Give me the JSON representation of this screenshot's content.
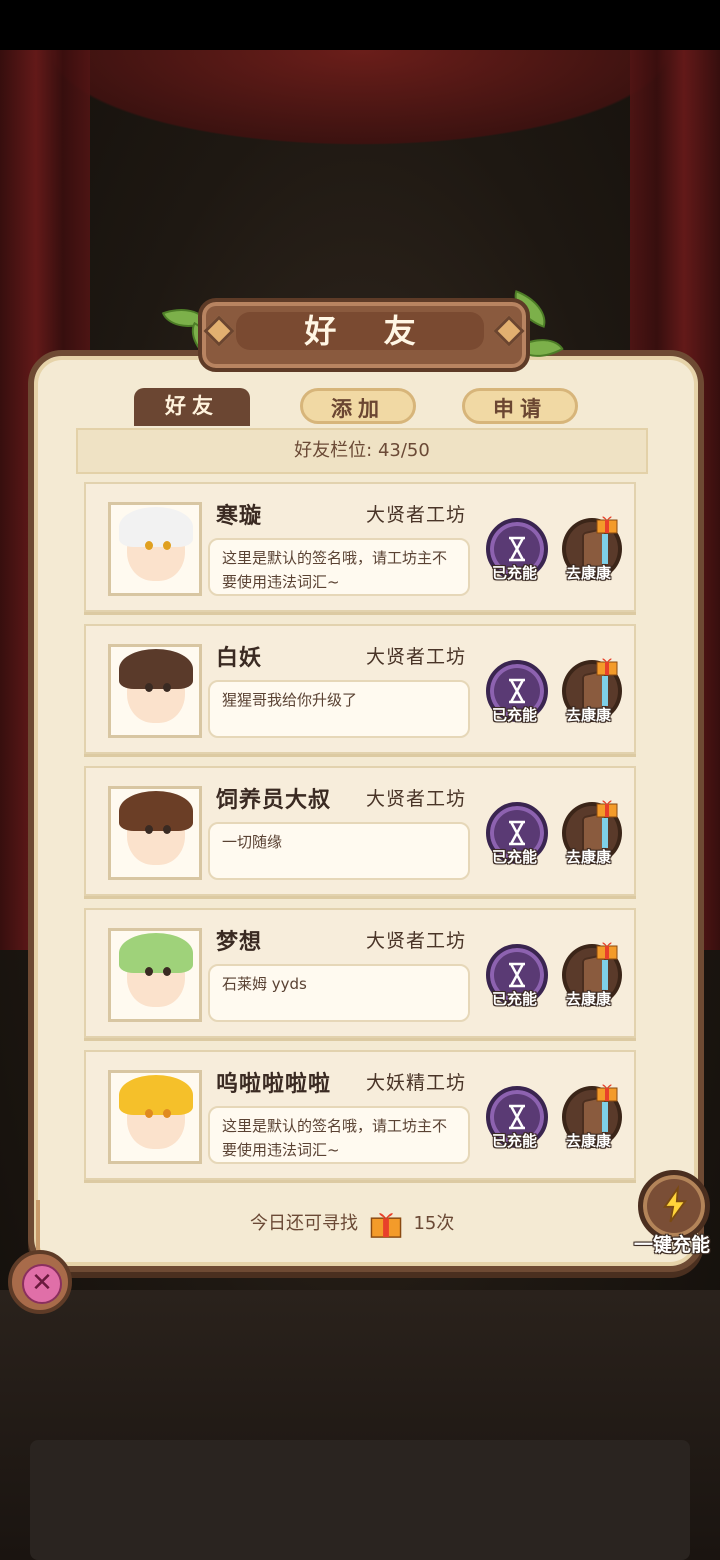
{
  "title": "好 友",
  "tabs": [
    {
      "label": "好友",
      "active": true
    },
    {
      "label": "添加",
      "active": false
    },
    {
      "label": "申请",
      "active": false
    }
  ],
  "slots_text": "好友栏位: 43/50",
  "friends": [
    {
      "name": "寒璇",
      "guild": "大贤者工坊",
      "signature": "这里是默认的签名哦，请工坊主不要使用违法词汇~",
      "hair_color": "#f2f2f2",
      "charge_label": "已充能",
      "visit_label": "去康康"
    },
    {
      "name": "白妖",
      "guild": "大贤者工坊",
      "signature": "猩猩哥我给你升级了",
      "hair_color": "#5a3a2a",
      "charge_label": "已充能",
      "visit_label": "去康康"
    },
    {
      "name": "饲养员大叔",
      "guild": "大贤者工坊",
      "signature": "一切随缘",
      "hair_color": "#6b3e26",
      "charge_label": "已充能",
      "visit_label": "去康康"
    },
    {
      "name": "梦想",
      "guild": "大贤者工坊",
      "signature": "石莱姆 yyds",
      "hair_color": "#9fd27a",
      "charge_label": "已充能",
      "visit_label": "去康康"
    },
    {
      "name": "呜啦啦啦啦",
      "guild": "大妖精工坊",
      "signature": "这里是默认的签名哦，请工坊主不要使用违法词汇~",
      "hair_color": "#f5c02a",
      "charge_label": "已充能",
      "visit_label": "去康康"
    }
  ],
  "footer": {
    "prefix": "今日还可寻找",
    "count": "15次"
  },
  "one_key_label": "一键充能",
  "icons": {
    "charged": "hourglass-icon",
    "visit": "door-icon",
    "gift": "gift-icon",
    "lightning": "lightning-icon",
    "close": "close-icon"
  }
}
